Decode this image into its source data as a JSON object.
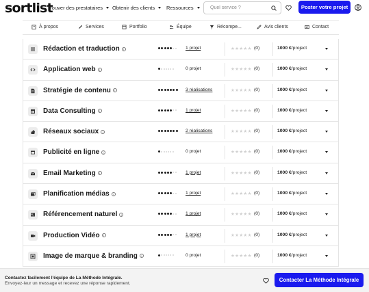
{
  "brand": {
    "logo_text": "sortlist",
    "accent": "#1a1aee"
  },
  "nav": {
    "items": [
      {
        "label": "Trouver des prestataires"
      },
      {
        "label": "Obtenir des clients"
      },
      {
        "label": "Ressources"
      }
    ],
    "search_placeholder": "Quel service ?",
    "post_button": "Poster votre projet"
  },
  "tabs": [
    {
      "label": "À propos",
      "icon": "building-icon"
    },
    {
      "label": "Services",
      "icon": "pen-icon"
    },
    {
      "label": "Portfolio",
      "icon": "portfolio-icon"
    },
    {
      "label": "Équipe",
      "icon": "team-icon"
    },
    {
      "label": "Récompe...",
      "icon": "award-icon"
    },
    {
      "label": "Avis clients",
      "icon": "review-icon"
    },
    {
      "label": "Contact",
      "icon": "contact-icon"
    }
  ],
  "services": [
    {
      "name": "Rédaction et traduction",
      "icon": "list-icon",
      "dots": 5,
      "projects": "1 projet",
      "linked": true,
      "rating_count": "(0)",
      "price_value": "1000 €",
      "price_unit": "/project"
    },
    {
      "name": "Application web",
      "icon": "code-icon",
      "dots": 1,
      "projects": "0 projet",
      "linked": false,
      "rating_count": "(0)",
      "price_value": "1000 €",
      "price_unit": "/project"
    },
    {
      "name": "Stratégie de contenu",
      "icon": "document-icon",
      "dots": 7,
      "projects": "3 réalisations",
      "linked": true,
      "rating_count": "(0)",
      "price_value": "1000 €",
      "price_unit": "/project"
    },
    {
      "name": "Data Consulting",
      "icon": "table-icon",
      "dots": 5,
      "projects": "1 projet",
      "linked": true,
      "rating_count": "(0)",
      "price_value": "1000 €",
      "price_unit": "/project"
    },
    {
      "name": "Réseaux sociaux",
      "icon": "thumbs-up-icon",
      "dots": 7,
      "projects": "2 réalisations",
      "linked": true,
      "rating_count": "(0)",
      "price_value": "1000 €",
      "price_unit": "/project"
    },
    {
      "name": "Publicité en ligne",
      "icon": "browser-icon",
      "dots": 1,
      "projects": "0 projet",
      "linked": false,
      "rating_count": "(0)",
      "price_value": "1000 €",
      "price_unit": "/project"
    },
    {
      "name": "Email Marketing",
      "icon": "mail-icon",
      "dots": 5,
      "projects": "1 projet",
      "linked": true,
      "rating_count": "(0)",
      "price_value": "1000 €",
      "price_unit": "/project"
    },
    {
      "name": "Planification médias",
      "icon": "media-icon",
      "dots": 5,
      "projects": "1 projet",
      "linked": true,
      "rating_count": "(0)",
      "price_value": "1000 €",
      "price_unit": "/project"
    },
    {
      "name": "Référencement naturel",
      "icon": "seo-icon",
      "dots": 5,
      "projects": "1 projet",
      "linked": true,
      "rating_count": "(0)",
      "price_value": "1000 €",
      "price_unit": "/project"
    },
    {
      "name": "Production Vidéo",
      "icon": "video-icon",
      "dots": 5,
      "projects": "1 projet",
      "linked": true,
      "rating_count": "(0)",
      "price_value": "1000 €",
      "price_unit": "/project"
    },
    {
      "name": "Image de marque & branding",
      "icon": "branding-icon",
      "dots": 1,
      "projects": "0 projet",
      "linked": false,
      "rating_count": "(0)",
      "price_value": "1000 €",
      "price_unit": "/project"
    }
  ],
  "contact_bar": {
    "title": "Contactez facilement l'équipe de La Méthode Intégrale.",
    "subtitle": "Envoyez-leur un message et recevez une réponse rapidement.",
    "button": "Contacter La Méthode Intégrale"
  }
}
